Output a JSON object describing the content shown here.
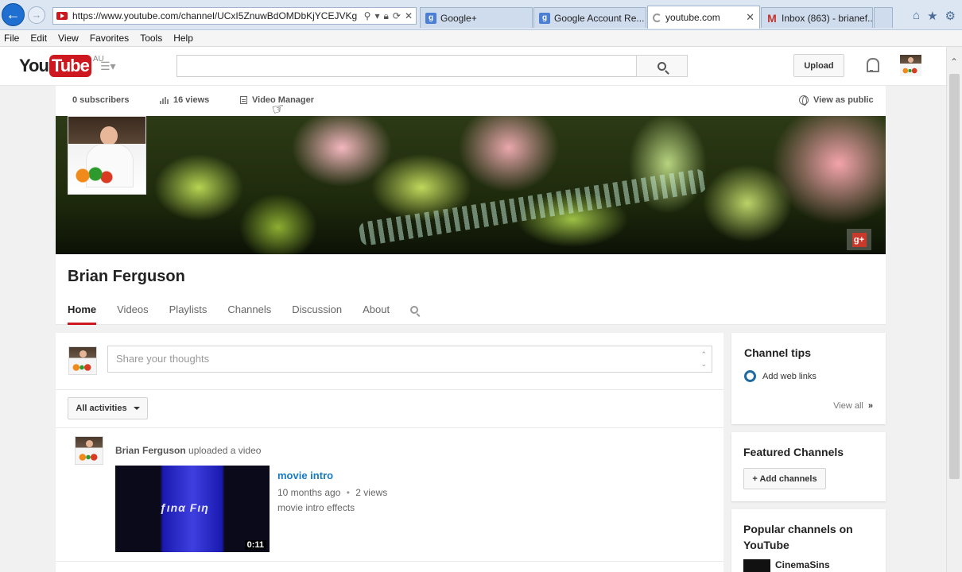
{
  "browser": {
    "url": "https://www.youtube.com/channel/UCxI5ZnuwBdOMDbKjYCEJVKg",
    "tabs": [
      {
        "label": "Google+"
      },
      {
        "label": "Google Account Re..."
      },
      {
        "label": "youtube.com"
      },
      {
        "label": "Inbox (863) - brianef..."
      }
    ],
    "menu": [
      "File",
      "Edit",
      "View",
      "Favorites",
      "Tools",
      "Help"
    ]
  },
  "masthead": {
    "logo_you": "You",
    "logo_tube": "Tube",
    "region": "AU",
    "upload_label": "Upload"
  },
  "channel": {
    "subscribers": "0 subscribers",
    "views": "16 views",
    "video_manager": "Video Manager",
    "view_as_public": "View as public",
    "name": "Brian Ferguson",
    "gplus": "g+",
    "tabs": [
      "Home",
      "Videos",
      "Playlists",
      "Channels",
      "Discussion",
      "About"
    ]
  },
  "feed": {
    "share_placeholder": "Share your thoughts",
    "activities_label": "All activities",
    "item": {
      "author": "Brian Ferguson",
      "action": "uploaded a video",
      "video_title": "movie intro",
      "age": "10 months ago",
      "separator": "•",
      "views": "2 views",
      "description": "movie intro effects",
      "duration": "0:11"
    }
  },
  "sidebar": {
    "tips_title": "Channel tips",
    "tips_item": "Add web links",
    "view_all": "View all",
    "featured_title": "Featured Channels",
    "add_channels": "+ Add channels",
    "popular_title": "Popular channels on YouTube",
    "popular_item": "CinemaSins"
  },
  "colors": {
    "youtube_red": "#cc181e",
    "link_blue": "#167ac6",
    "tip_ring": "#1f6aa0"
  }
}
